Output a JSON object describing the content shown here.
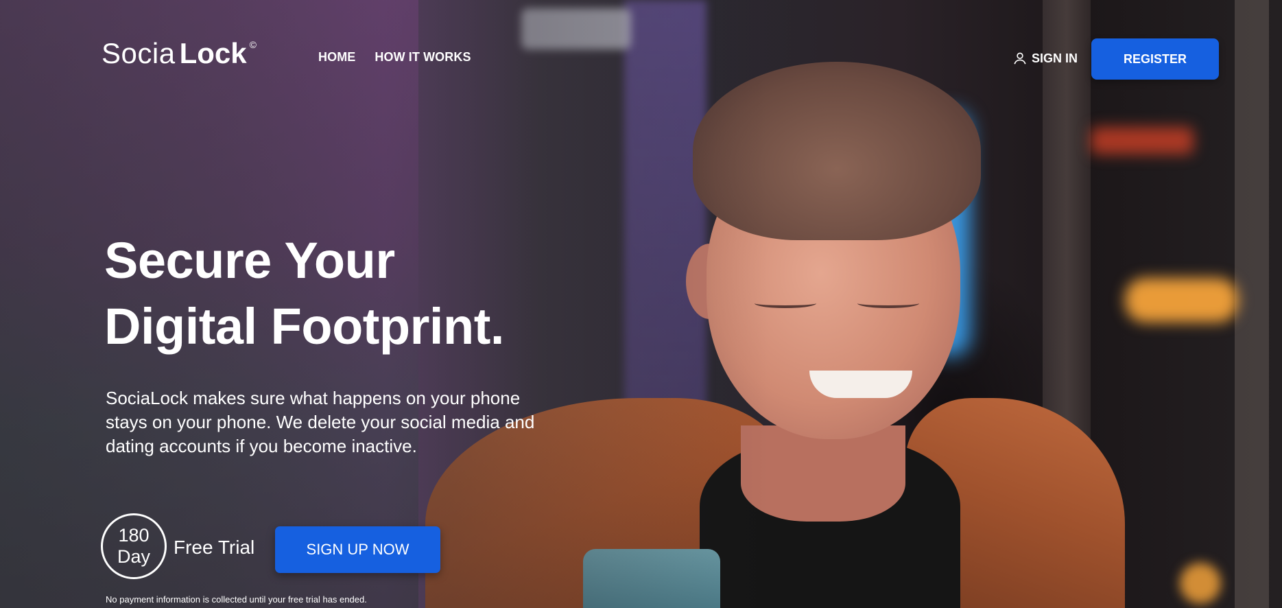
{
  "brand": {
    "name_light": "Socia",
    "name_bold": "Lock",
    "mark": "©"
  },
  "nav": {
    "items": [
      {
        "label": "HOME"
      },
      {
        "label": "HOW IT WORKS"
      }
    ]
  },
  "header": {
    "signin_label": "SIGN IN",
    "signin_icon": "user-icon",
    "register_label": "REGISTER"
  },
  "hero": {
    "headline_line1": "Secure Your",
    "headline_line2": "Digital Footprint.",
    "subtitle": "SociaLock makes sure what happens on your phone stays on your phone. We delete your social media and dating accounts if you become inactive.",
    "badge_number": "180",
    "badge_unit": "Day",
    "trial_label": "Free Trial",
    "cta_label": "SIGN UP NOW",
    "disclaimer": "No payment information is collected until your free trial has ended."
  },
  "colors": {
    "primary_button": "#1660e0",
    "text": "#ffffff"
  }
}
